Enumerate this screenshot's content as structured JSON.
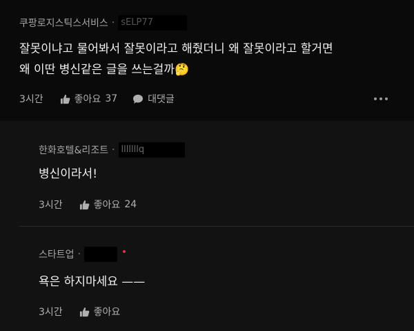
{
  "comment": {
    "author": "쿠팡로지스틱스서비스",
    "author_id": "sELP77",
    "text_line1": "잘못이냐고 물어봐서 잘못이라고 해줬더니 왜 잘못이라고 할거면",
    "text_line2": "왜 이딴 병신같은 글을 쓰는걸까",
    "emoji": "🤔",
    "time": "3시간",
    "like_label": "좋아요",
    "like_count": "37",
    "reply_label": "대댓글"
  },
  "replies": [
    {
      "author": "한화호텔&리조트",
      "author_id": "lllllllq",
      "text": "병신이라서!",
      "time": "3시간",
      "like_label": "좋아요",
      "like_count": "24"
    },
    {
      "author": "스타트업",
      "author_id": "",
      "text": "욕은 하지마세요 ——",
      "time": "3시간",
      "like_label": "좋아요",
      "like_count": ""
    }
  ],
  "colors": {
    "background": "#0a0a0a",
    "reply_background": "#121212",
    "badge_red": "#e0353b"
  }
}
